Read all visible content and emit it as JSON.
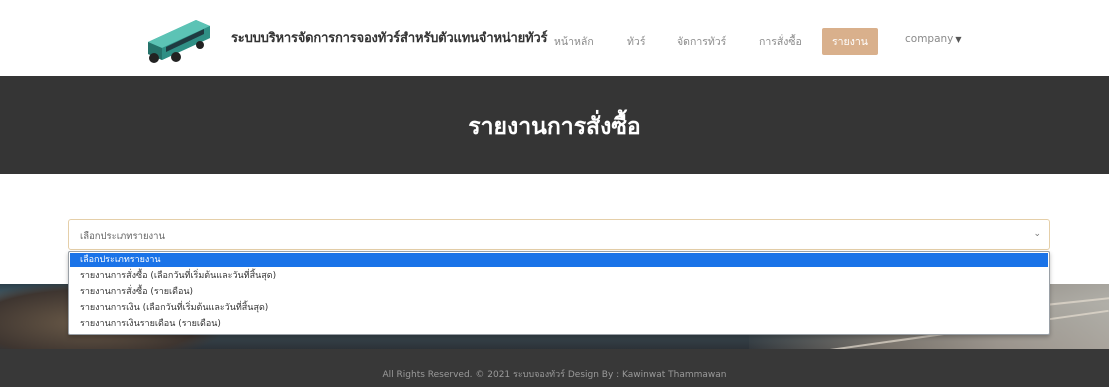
{
  "navbar": {
    "logo_icon": "bus-icon",
    "brand": "ระบบบริหารจัดการการจองทัวร์สำหรับตัวแทนจำหน่ายทัวร์",
    "items": [
      {
        "label": "หน้าหลัก"
      },
      {
        "label": "ทัวร์"
      },
      {
        "label": "จัดการทัวร์"
      },
      {
        "label": "การสั่งซื้อ"
      },
      {
        "label": "รายงาน",
        "active": true
      },
      {
        "label": "company"
      }
    ],
    "accent_color": "#d9b08c"
  },
  "banner": {
    "title": "รายงานการสั่งซื้อ"
  },
  "report_select": {
    "value": "เลือกประเภทรายงาน",
    "options": [
      {
        "label": "เลือกประเภทรายงาน",
        "selected": true
      },
      {
        "label": "รายงานการสั่งซื้อ (เลือกวันที่เริ่มต้นและวันที่สิ้นสุด)"
      },
      {
        "label": "รายงานการสั่งซื้อ (รายเดือน)"
      },
      {
        "label": "รายงานการเงิน (เลือกวันที่เริ่มต้นและวันที่สิ้นสุด)"
      },
      {
        "label": "รายงานการเงินรายเดือน (รายเดือน)"
      }
    ],
    "selected_color": "#1a73e8"
  },
  "footer": {
    "text": "All Rights Reserved. © 2021 ระบบจองทัวร์ Design By : Kawinwat Thammawan"
  }
}
